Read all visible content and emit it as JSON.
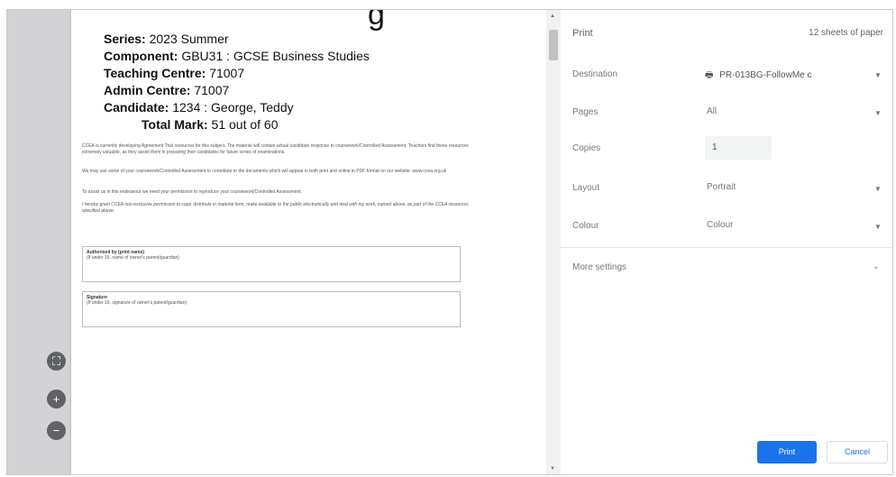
{
  "top_fragment": "g",
  "document": {
    "series_label": "Series:",
    "series_value": " 2023 Summer",
    "component_label": "Component:",
    "component_value": " GBU31 : GCSE Business Studies",
    "teaching_label": "Teaching Centre:",
    "teaching_value": " 71007",
    "admin_label": "Admin Centre:",
    "admin_value": " 71007",
    "candidate_label": "Candidate:",
    "candidate_value": " 1234 : George, Teddy",
    "total_label": "Total Mark:",
    "total_value": " 51 out of 60",
    "para1": "CCEA is currently developing Agreement Trial resources for this subject. The material will contain actual candidate response to coursework/Controlled Assessment. Teachers find these resources extremely valuable, as they assist them in preparing their candidates for future series of examinations.",
    "para2": "We may use some of your coursework/Controlled Assessment to contribute to the documents which will appear in both print and online in PDF format on our website: www.ccea.org.uk",
    "para3": "To assist us in this endeavour we need your permission to reproduce your coursework/Controlled Assessment.",
    "para4": "I hereby grant CCEA non-exclusive permission to copy, distribute in material form, make available to the public electronically and deal with my work, named above, as part of the CCEA resources specified above.",
    "auth_title": "Authorised by (print name)",
    "auth_sub": "(If under 16, name of owner's parent/guardian)",
    "sig_title": "Signature",
    "sig_sub": "(If under 16, signature of owner's parent/guardian)"
  },
  "print_panel": {
    "title": "Print",
    "sheets": "12 sheets of paper",
    "destination_label": "Destination",
    "destination_value": "PR-013BG-FollowMe c",
    "pages_label": "Pages",
    "pages_value": "All",
    "copies_label": "Copies",
    "copies_value": "1",
    "layout_label": "Layout",
    "layout_value": "Portrait",
    "colour_label": "Colour",
    "colour_value": "Colour",
    "more_settings": "More settings",
    "print_button": "Print",
    "cancel_button": "Cancel"
  },
  "icons": {
    "fit": "fit-to-page-icon",
    "zoom_in": "zoom-in-icon",
    "zoom_out": "zoom-out-icon",
    "printer": "printer-icon",
    "chevron": "chevron-down-icon"
  },
  "colors": {
    "print_button_bg": "#1a73e8",
    "preview_bg": "#d3d3d6",
    "zoom_button_bg": "#5f6368"
  }
}
